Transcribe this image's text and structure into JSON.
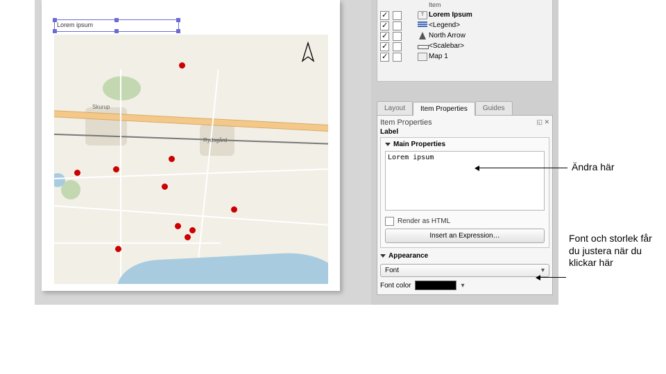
{
  "canvas": {
    "title_item_text": "Lorem ipsum",
    "towns": {
      "skurup": "Skurup",
      "rydsgard": "Rydsgård"
    }
  },
  "layers": {
    "header_item": "Item",
    "items": [
      {
        "checked": true,
        "icon": "text",
        "label": "Lorem Ipsum",
        "bold": true
      },
      {
        "checked": true,
        "icon": "legend",
        "label": "<Legend>"
      },
      {
        "checked": true,
        "icon": "north",
        "label": "North Arrow"
      },
      {
        "checked": true,
        "icon": "scale",
        "label": "<Scalebar>"
      },
      {
        "checked": true,
        "icon": "map",
        "label": "Map 1"
      }
    ]
  },
  "tabs": {
    "layout": "Layout",
    "item_props": "Item Properties",
    "guides": "Guides"
  },
  "props": {
    "panel_title": "Item Properties",
    "sub_label": "Label",
    "main": {
      "header": "Main Properties",
      "text_value": "Lorem ipsum",
      "render_html": "Render as HTML",
      "insert_expr": "Insert an Expression…"
    },
    "appearance": {
      "header": "Appearance",
      "font_label": "Font",
      "font_color_label": "Font color"
    }
  },
  "annotations": {
    "a1": "Ändra här",
    "a2": "Font och storlek får du justera när du klickar här"
  }
}
